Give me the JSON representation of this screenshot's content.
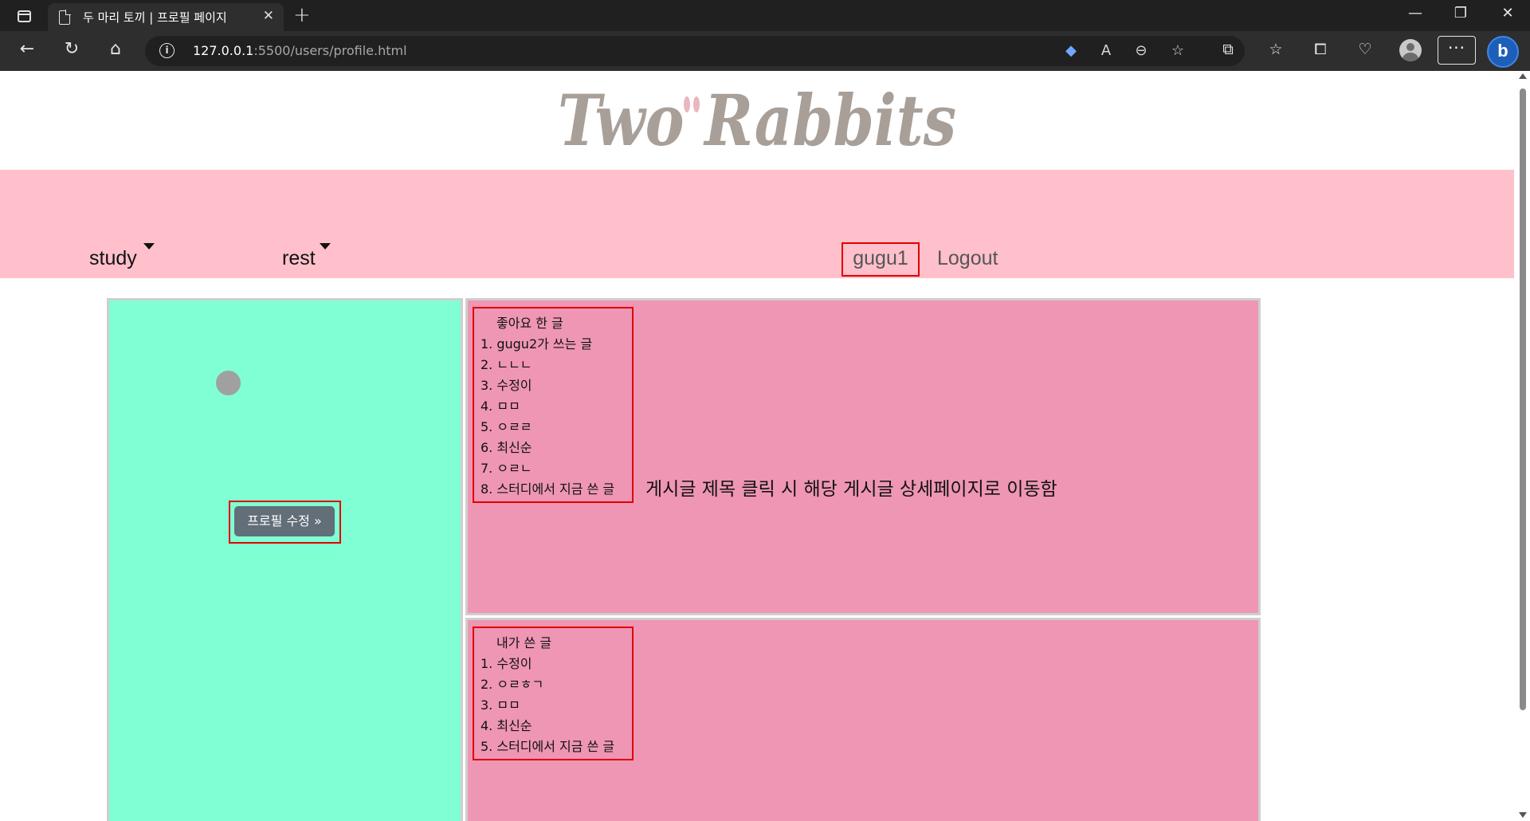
{
  "browser": {
    "tab_title": "두 마리 토끼 | 프로필 페이지",
    "url_host": "127.0.0.1",
    "url_rest": ":5500/users/profile.html"
  },
  "header": {
    "logo_text": "Two Rabbits"
  },
  "navbar": {
    "study_label": "study",
    "rest_label": "rest",
    "username": "gugu1",
    "logout_label": "Logout"
  },
  "profile": {
    "edit_button_label": "프로필 수정 »"
  },
  "liked_posts": {
    "title": "좋아요 한 글",
    "items": [
      "1. gugu2가 쓰는 글",
      "2. ㄴㄴㄴ",
      "3. 수정이",
      "4. ㅁㅁ",
      "5. ㅇㄹㄹ",
      "6. 최신순",
      "7. ㅇㄹㄴ",
      "8. 스터디에서 지금 쓴 글"
    ]
  },
  "hint": {
    "text": "게시글 제목 클릭 시 해당 게시글 상세페이지로 이동함"
  },
  "my_posts": {
    "title": "내가 쓴 글",
    "items": [
      "1. 수정이",
      "2. ㅇㄹㅎㄱ",
      "3. ㅁㅁ",
      "4. 최신순",
      "5. 스터디에서 지금 쓴 글"
    ]
  }
}
